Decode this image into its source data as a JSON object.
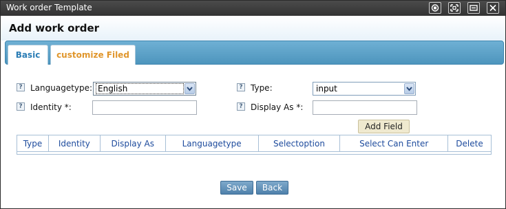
{
  "window": {
    "title": "Work order Template",
    "controls": [
      "restore-icon",
      "maximize-icon",
      "minimize-icon",
      "close-icon"
    ]
  },
  "header": {
    "title": "Add work order"
  },
  "tabs": [
    {
      "label": "Basic",
      "active": false
    },
    {
      "label": "customize Filed",
      "active": true
    }
  ],
  "form": {
    "languagetype": {
      "label": "Languagetype:",
      "value": "English"
    },
    "type": {
      "label": "Type:",
      "value": "input"
    },
    "identity": {
      "label": "Identity *:",
      "value": ""
    },
    "display_as": {
      "label": "Display As *:",
      "value": ""
    },
    "help_icon": "?"
  },
  "add_field_label": "Add Field",
  "table": {
    "columns": [
      "Type",
      "Identity",
      "Display As",
      "Languagetype",
      "Selectoption",
      "Select Can Enter",
      "Delete"
    ],
    "rows": []
  },
  "footer": {
    "save_label": "Save",
    "back_label": "Back"
  },
  "colors": {
    "tabbar": "#5a9ec6",
    "active_tab_text": "#e0962c",
    "header_text": "#1c4a9c",
    "button_blue": "#5f8fb6"
  }
}
